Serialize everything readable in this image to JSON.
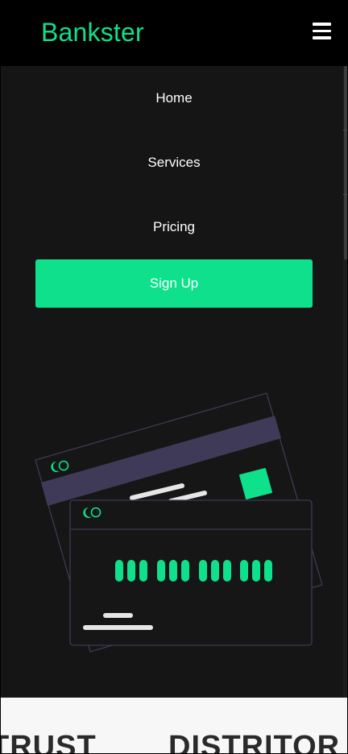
{
  "header": {
    "brand": "Bankster",
    "menu_icon": "hamburger-menu-icon"
  },
  "nav": {
    "items": [
      {
        "label": "Home"
      },
      {
        "label": "Services"
      },
      {
        "label": "Pricing"
      }
    ],
    "signup_label": "Sign Up"
  },
  "colors": {
    "accent": "#0ee08c",
    "background": "#151515",
    "header": "#000000",
    "card_stripe": "#3f3a57"
  },
  "illustration": {
    "icons": [
      "credit-card-back-icon",
      "credit-card-front-icon"
    ]
  },
  "partners": {
    "words": [
      "TRUST",
      "DISTRITOR"
    ]
  }
}
